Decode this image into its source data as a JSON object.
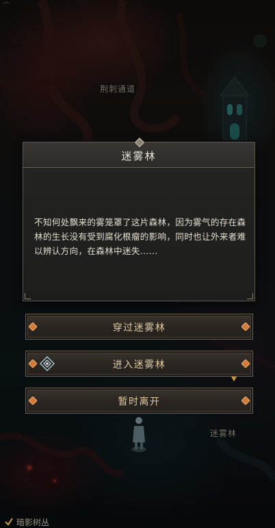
{
  "map": {
    "label_thorn_passage": "荆刺通道",
    "label_mist_forest": "迷雾林",
    "label_shadow_thicket": "暗影树丛",
    "top_glyph": "⌒"
  },
  "dialog": {
    "title": "迷雾林",
    "body": "不知何处飘来的雾笼罩了这片森林，因为雾气的存在森林的生长没有受到腐化根瘤的影响，同时也让外来者难以辨认方向，在森林中迷失......"
  },
  "options": [
    {
      "label": "穿过迷雾林"
    },
    {
      "label": "进入迷雾林"
    },
    {
      "label": "暂时离开"
    }
  ],
  "colors": {
    "option_text": "#dcc9a3",
    "gem": "#d27a3a",
    "accent_arrow": "#c49a3a"
  },
  "icons": {
    "option_gem": "diamond-gem-icon",
    "enter_option_icon": "rune-diamond-icon",
    "checkbox": "check-icon"
  }
}
